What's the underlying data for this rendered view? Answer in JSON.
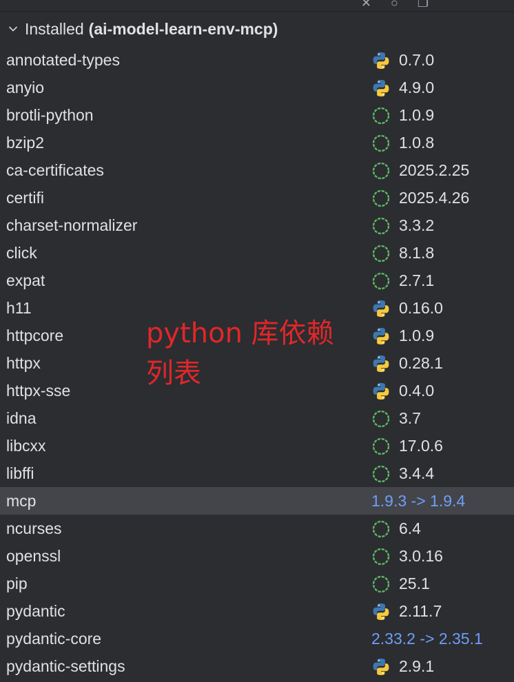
{
  "header": {
    "label": "Installed",
    "environment": "(ai-model-learn-env-mcp)"
  },
  "annotation": {
    "line1": "python 库依赖",
    "line2": "列表"
  },
  "packages": [
    {
      "name": "annotated-types",
      "version": "0.7.0",
      "source": "python-icon"
    },
    {
      "name": "anyio",
      "version": "4.9.0",
      "source": "python-icon"
    },
    {
      "name": "brotli-python",
      "version": "1.0.9",
      "source": "conda-icon"
    },
    {
      "name": "bzip2",
      "version": "1.0.8",
      "source": "conda-icon"
    },
    {
      "name": "ca-certificates",
      "version": "2025.2.25",
      "source": "conda-icon"
    },
    {
      "name": "certifi",
      "version": "2025.4.26",
      "source": "conda-icon"
    },
    {
      "name": "charset-normalizer",
      "version": "3.3.2",
      "source": "conda-icon"
    },
    {
      "name": "click",
      "version": "8.1.8",
      "source": "conda-icon"
    },
    {
      "name": "expat",
      "version": "2.7.1",
      "source": "conda-icon"
    },
    {
      "name": "h11",
      "version": "0.16.0",
      "source": "python-icon"
    },
    {
      "name": "httpcore",
      "version": "1.0.9",
      "source": "python-icon"
    },
    {
      "name": "httpx",
      "version": "0.28.1",
      "source": "python-icon"
    },
    {
      "name": "httpx-sse",
      "version": "0.4.0",
      "source": "python-icon"
    },
    {
      "name": "idna",
      "version": "3.7",
      "source": "conda-icon"
    },
    {
      "name": "libcxx",
      "version": "17.0.6",
      "source": "conda-icon"
    },
    {
      "name": "libffi",
      "version": "3.4.4",
      "source": "conda-icon"
    },
    {
      "name": "mcp",
      "upgrade": "1.9.3 -> 1.9.4",
      "selected": true
    },
    {
      "name": "ncurses",
      "version": "6.4",
      "source": "conda-icon"
    },
    {
      "name": "openssl",
      "version": "3.0.16",
      "source": "conda-icon"
    },
    {
      "name": "pip",
      "version": "25.1",
      "source": "conda-icon"
    },
    {
      "name": "pydantic",
      "version": "2.11.7",
      "source": "python-icon"
    },
    {
      "name": "pydantic-core",
      "upgrade": "2.33.2 -> 2.35.1"
    },
    {
      "name": "pydantic-settings",
      "version": "2.9.1",
      "source": "python-icon"
    }
  ],
  "colors": {
    "background": "#2b2d30",
    "selected_row": "#43454a",
    "text": "#dfe1e5",
    "upgrade_link": "#6f9ff6",
    "annotation": "#e0272a",
    "conda_green": "#5fb865",
    "python_blue": "#3f78b0",
    "python_yellow": "#f5c93f"
  }
}
